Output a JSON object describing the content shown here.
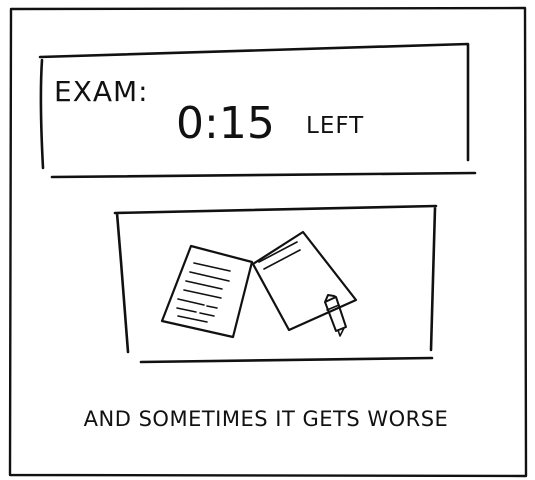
{
  "panel": {
    "header": {
      "exam_label": "EXAM:",
      "time_remaining": "0:15",
      "left_label": "LEFT"
    },
    "caption": "AND SOMETIMES IT GETS WORSE"
  }
}
